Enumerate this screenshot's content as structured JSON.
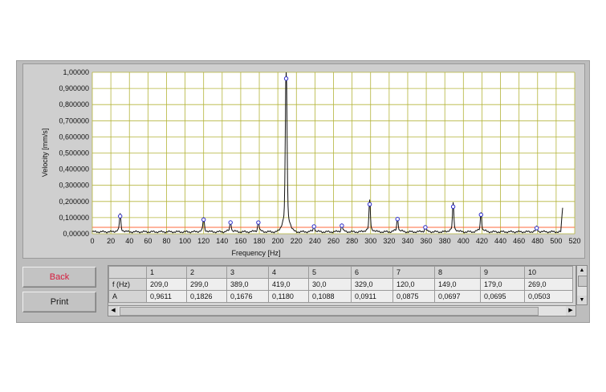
{
  "buttons": {
    "back": "Back",
    "print": "Print"
  },
  "chart_data": {
    "type": "line",
    "xlabel": "Frequency [Hz]",
    "ylabel": "Velocity [mm/s]",
    "xlim": [
      0,
      520
    ],
    "ylim": [
      0,
      1.0
    ],
    "x_ticks": [
      "0",
      "20",
      "40",
      "60",
      "80",
      "100",
      "120",
      "140",
      "160",
      "180",
      "200",
      "220",
      "240",
      "260",
      "280",
      "300",
      "320",
      "340",
      "360",
      "380",
      "400",
      "420",
      "440",
      "460",
      "480",
      "500",
      "520"
    ],
    "y_ticks": [
      "0,00000",
      "0,100000",
      "0,200000",
      "0,300000",
      "0,400000",
      "0,500000",
      "0,600000",
      "0,700000",
      "0,800000",
      "0,900000",
      "1,00000"
    ],
    "grid": true,
    "threshold": 0.04,
    "peaks": [
      {
        "f": 30,
        "a": 0.1088
      },
      {
        "f": 120,
        "a": 0.0875
      },
      {
        "f": 149,
        "a": 0.0697
      },
      {
        "f": 179,
        "a": 0.0695
      },
      {
        "f": 209,
        "a": 0.9611
      },
      {
        "f": 239,
        "a": 0.045
      },
      {
        "f": 269,
        "a": 0.0503
      },
      {
        "f": 299,
        "a": 0.1826
      },
      {
        "f": 329,
        "a": 0.0911
      },
      {
        "f": 359,
        "a": 0.04
      },
      {
        "f": 389,
        "a": 0.1676
      },
      {
        "f": 419,
        "a": 0.118
      },
      {
        "f": 479,
        "a": 0.035
      }
    ],
    "end_rise": {
      "f": 507,
      "a": 0.17
    }
  },
  "table": {
    "row_headers": [
      "f  (Hz)",
      "A"
    ],
    "columns": [
      "1",
      "2",
      "3",
      "4",
      "5",
      "6",
      "7",
      "8",
      "9",
      "10"
    ],
    "f": [
      "209,0",
      "299,0",
      "389,0",
      "419,0",
      "30,0",
      "329,0",
      "120,0",
      "149,0",
      "179,0",
      "269,0"
    ],
    "A": [
      "0,9611",
      "0,1826",
      "0,1676",
      "0,1180",
      "0,1088",
      "0,0911",
      "0,0875",
      "0,0697",
      "0,0695",
      "0,0503"
    ]
  },
  "colors": {
    "grid": "#b4b43a",
    "threshold": "#ff6a3c",
    "trace": "#111111",
    "peak_marker": "#2c2ccc",
    "plot_bg": "#ffffff"
  }
}
